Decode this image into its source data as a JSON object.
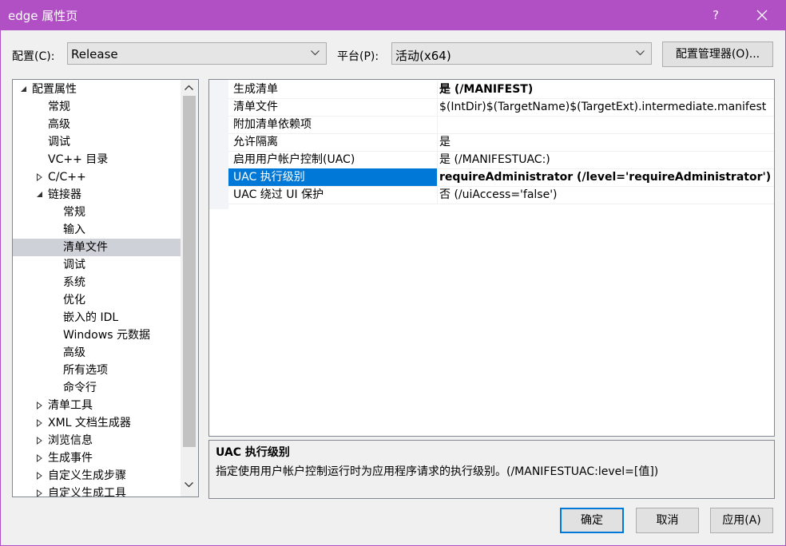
{
  "window": {
    "title": "edge 属性页",
    "help": "?"
  },
  "config": {
    "label": "配置(C):",
    "value": "Release"
  },
  "platform": {
    "label": "平台(P):",
    "value": "活动(x64)"
  },
  "buttons": {
    "config_manager": "配置管理器(O)...",
    "ok": "确定",
    "cancel": "取消",
    "apply": "应用(A)"
  },
  "tree": [
    {
      "label": "配置属性",
      "level": 0,
      "expander": "expanded"
    },
    {
      "label": "常规",
      "level": 1,
      "expander": "none"
    },
    {
      "label": "高级",
      "level": 1,
      "expander": "none"
    },
    {
      "label": "调试",
      "level": 1,
      "expander": "none"
    },
    {
      "label": "VC++ 目录",
      "level": 1,
      "expander": "none"
    },
    {
      "label": "C/C++",
      "level": 1,
      "expander": "collapsed"
    },
    {
      "label": "链接器",
      "level": 1,
      "expander": "expanded"
    },
    {
      "label": "常规",
      "level": 2,
      "expander": "none"
    },
    {
      "label": "输入",
      "level": 2,
      "expander": "none"
    },
    {
      "label": "清单文件",
      "level": 2,
      "expander": "none",
      "selected": true
    },
    {
      "label": "调试",
      "level": 2,
      "expander": "none"
    },
    {
      "label": "系统",
      "level": 2,
      "expander": "none"
    },
    {
      "label": "优化",
      "level": 2,
      "expander": "none"
    },
    {
      "label": "嵌入的 IDL",
      "level": 2,
      "expander": "none"
    },
    {
      "label": "Windows 元数据",
      "level": 2,
      "expander": "none"
    },
    {
      "label": "高级",
      "level": 2,
      "expander": "none"
    },
    {
      "label": "所有选项",
      "level": 2,
      "expander": "none"
    },
    {
      "label": "命令行",
      "level": 2,
      "expander": "none"
    },
    {
      "label": "清单工具",
      "level": 1,
      "expander": "collapsed"
    },
    {
      "label": "XML 文档生成器",
      "level": 1,
      "expander": "collapsed"
    },
    {
      "label": "浏览信息",
      "level": 1,
      "expander": "collapsed"
    },
    {
      "label": "生成事件",
      "level": 1,
      "expander": "collapsed"
    },
    {
      "label": "自定义生成步骤",
      "level": 1,
      "expander": "collapsed"
    },
    {
      "label": "自定义生成工具",
      "level": 1,
      "expander": "collapsed"
    }
  ],
  "properties": [
    {
      "name": "生成清单",
      "value": "是 (/MANIFEST)",
      "bold": true
    },
    {
      "name": "清单文件",
      "value": "$(IntDir)$(TargetName)$(TargetExt).intermediate.manifest"
    },
    {
      "name": "附加清单依赖项",
      "value": ""
    },
    {
      "name": "允许隔离",
      "value": "是"
    },
    {
      "name": "启用用户帐户控制(UAC)",
      "value": "是 (/MANIFESTUAC:)"
    },
    {
      "name": "UAC 执行级别",
      "value": "requireAdministrator (/level='requireAdministrator')",
      "bold": true,
      "active": true
    },
    {
      "name": "UAC 绕过 UI 保护",
      "value": "否 (/uiAccess='false')"
    }
  ],
  "description": {
    "title": "UAC 执行级别",
    "text": "指定使用用户帐户控制运行时为应用程序请求的执行级别。(/MANIFESTUAC:level=[值])"
  }
}
